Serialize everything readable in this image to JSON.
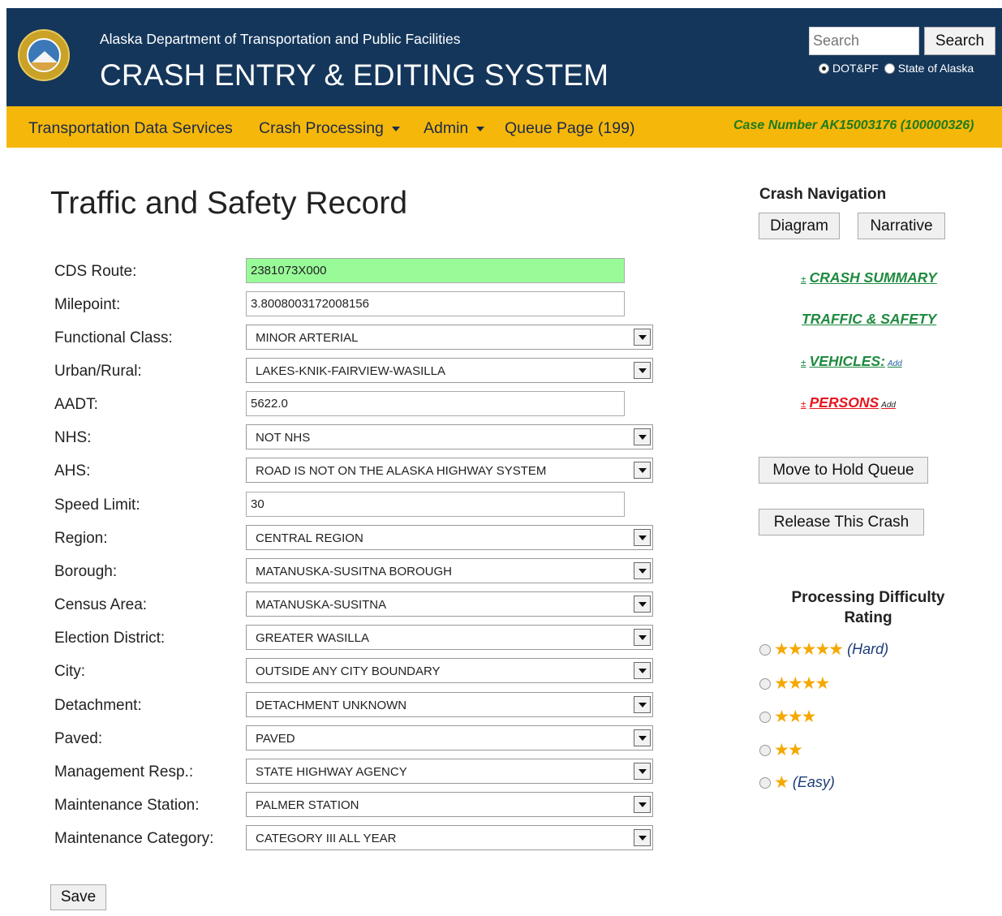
{
  "header": {
    "agency": "Alaska Department of Transportation and Public Facilities",
    "system_title": "CRASH ENTRY & EDITING SYSTEM",
    "search_placeholder": "Search",
    "search_button": "Search",
    "radio_options": [
      {
        "label": "DOT&PF",
        "checked": true
      },
      {
        "label": "State of Alaska",
        "checked": false
      }
    ]
  },
  "nav": {
    "items": [
      "Transportation Data Services",
      "Crash Processing",
      "Admin",
      "Queue Page (199)"
    ],
    "case_number": "Case Number AK15003176 (100000326)"
  },
  "main": {
    "title": "Traffic and Safety Record",
    "fields": [
      {
        "label": "CDS Route:",
        "type": "text",
        "value": "2381073X000",
        "highlight": "#98fb98"
      },
      {
        "label": "Milepoint:",
        "type": "text",
        "value": "3.8008003172008156"
      },
      {
        "label": "Functional Class:",
        "type": "select",
        "value": "MINOR ARTERIAL"
      },
      {
        "label": "Urban/Rural:",
        "type": "select",
        "value": "LAKES-KNIK-FAIRVIEW-WASILLA"
      },
      {
        "label": "AADT:",
        "type": "text",
        "value": "5622.0"
      },
      {
        "label": "NHS:",
        "type": "select",
        "value": "NOT NHS"
      },
      {
        "label": "AHS:",
        "type": "select",
        "value": "ROAD IS NOT ON THE ALASKA HIGHWAY SYSTEM"
      },
      {
        "label": "Speed Limit:",
        "type": "text",
        "value": "30"
      },
      {
        "label": "Region:",
        "type": "select",
        "value": "CENTRAL REGION"
      },
      {
        "label": "Borough:",
        "type": "select",
        "value": "MATANUSKA-SUSITNA BOROUGH"
      },
      {
        "label": "Census Area:",
        "type": "select",
        "value": "MATANUSKA-SUSITNA"
      },
      {
        "label": "Election District:",
        "type": "select",
        "value": "GREATER WASILLA"
      },
      {
        "label": "City:",
        "type": "select",
        "value": "OUTSIDE ANY CITY BOUNDARY"
      },
      {
        "label": "Detachment:",
        "type": "select",
        "value": "DETACHMENT UNKNOWN"
      },
      {
        "label": "Paved:",
        "type": "select",
        "value": "PAVED"
      },
      {
        "label": "Management Resp.:",
        "type": "select",
        "value": "STATE HIGHWAY AGENCY"
      },
      {
        "label": "Maintenance Station:",
        "type": "select",
        "value": "PALMER STATION"
      },
      {
        "label": "Maintenance Category:",
        "type": "select",
        "value": "CATEGORY III ALL YEAR"
      }
    ],
    "save_button": "Save"
  },
  "sidebar": {
    "heading": "Crash Navigation",
    "diagram_button": "Diagram",
    "narrative_button": "Narrative",
    "links": [
      {
        "prefix": "±",
        "label": "CRASH SUMMARY",
        "add": "",
        "color": "#1f8a3f"
      },
      {
        "prefix": "",
        "label": "TRAFFIC & SAFETY",
        "add": "",
        "color": "#1f8a3f"
      },
      {
        "prefix": "±",
        "label": "VEHICLES:",
        "add": "Add",
        "color": "#1f8a3f"
      },
      {
        "prefix": "±",
        "label": "PERSONS",
        "add": "Add",
        "color": "#e8141e"
      }
    ],
    "hold_queue_button": "Move to Hold Queue",
    "release_button": "Release This Crash",
    "rating_heading": "Processing Difficulty Rating",
    "ratings": [
      {
        "stars": 5,
        "label": "(Hard)"
      },
      {
        "stars": 4,
        "label": ""
      },
      {
        "stars": 3,
        "label": ""
      },
      {
        "stars": 2,
        "label": ""
      },
      {
        "stars": 1,
        "label": "(Easy)"
      }
    ]
  }
}
